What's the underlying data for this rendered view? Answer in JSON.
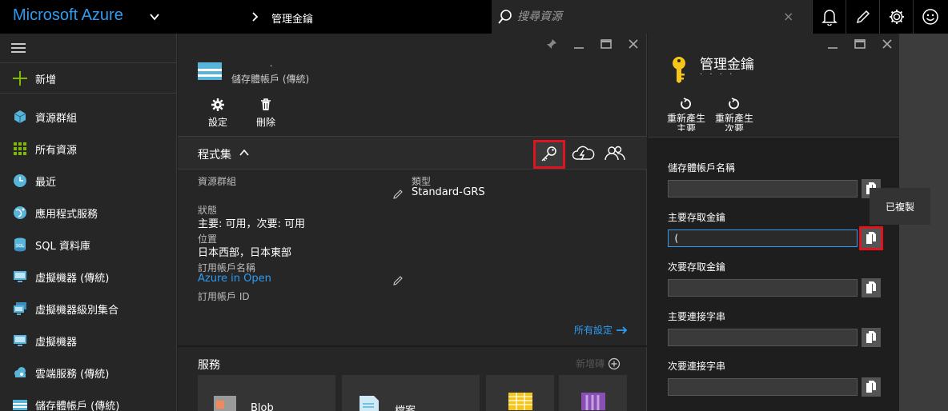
{
  "topbar": {
    "brand": "Microsoft Azure",
    "breadcrumb": "管理金鑰",
    "search_placeholder": "搜尋資源",
    "clear_glyph": "×"
  },
  "nav": {
    "items": [
      {
        "label": "新增",
        "icon": "plus-icon"
      },
      {
        "label": "資源群組",
        "icon": "cube-icon"
      },
      {
        "label": "所有資源",
        "icon": "grid-icon"
      },
      {
        "label": "最近",
        "icon": "clock-icon"
      },
      {
        "label": "應用程式服務",
        "icon": "globe-icon"
      },
      {
        "label": "SQL 資料庫",
        "icon": "database-icon"
      },
      {
        "label": "虛擬機器 (傳統)",
        "icon": "monitor-icon"
      },
      {
        "label": "虛擬機器級別集合",
        "icon": "monitor-stack-icon"
      },
      {
        "label": "虛擬機器",
        "icon": "monitor-icon"
      },
      {
        "label": "雲端服務 (傳統)",
        "icon": "cloud-icon"
      },
      {
        "label": "儲存體帳戶 (傳統)",
        "icon": "storage-icon"
      }
    ]
  },
  "blade1": {
    "dot": "·",
    "subtitle": "儲存體帳戶 (傳統)",
    "commands": {
      "settings": "設定",
      "delete": "刪除"
    },
    "essentials_title": "程式集",
    "essentials": {
      "resource_group_label": "資源群組",
      "status_label": "狀態",
      "status_value": "主要: 可用，次要: 可用",
      "location_label": "位置",
      "location_value": "日本西部，日本東部",
      "subscription_name_label": "訂用帳戶名稱",
      "subscription_name_value": "Azure in Open",
      "subscription_id_label": "訂用帳戶 ID",
      "type_label": "類型",
      "type_value": "Standard-GRS"
    },
    "all_settings": "所有設定",
    "services_title": "服務",
    "add_tile": "新增磚",
    "tiles": [
      {
        "label": "Blob"
      },
      {
        "label": "檔案"
      }
    ]
  },
  "blade2": {
    "title": "管理金鑰",
    "subtitle": "·  ·  ·  ·",
    "regen_primary": "重新產生主要",
    "regen_secondary": "重新產生次要",
    "fields": [
      {
        "label": "儲存體帳戶名稱",
        "value": ""
      },
      {
        "label": "主要存取金鑰",
        "value": "(                                 ("
      },
      {
        "label": "次要存取金鑰",
        "value": ""
      },
      {
        "label": "主要連接字串",
        "value": ""
      },
      {
        "label": "次要連接字串",
        "value": ""
      }
    ],
    "tooltip": "已複製"
  },
  "colors": {
    "accent": "#2e9cf2",
    "highlight": "#e0141e",
    "key": "#f5c518"
  }
}
